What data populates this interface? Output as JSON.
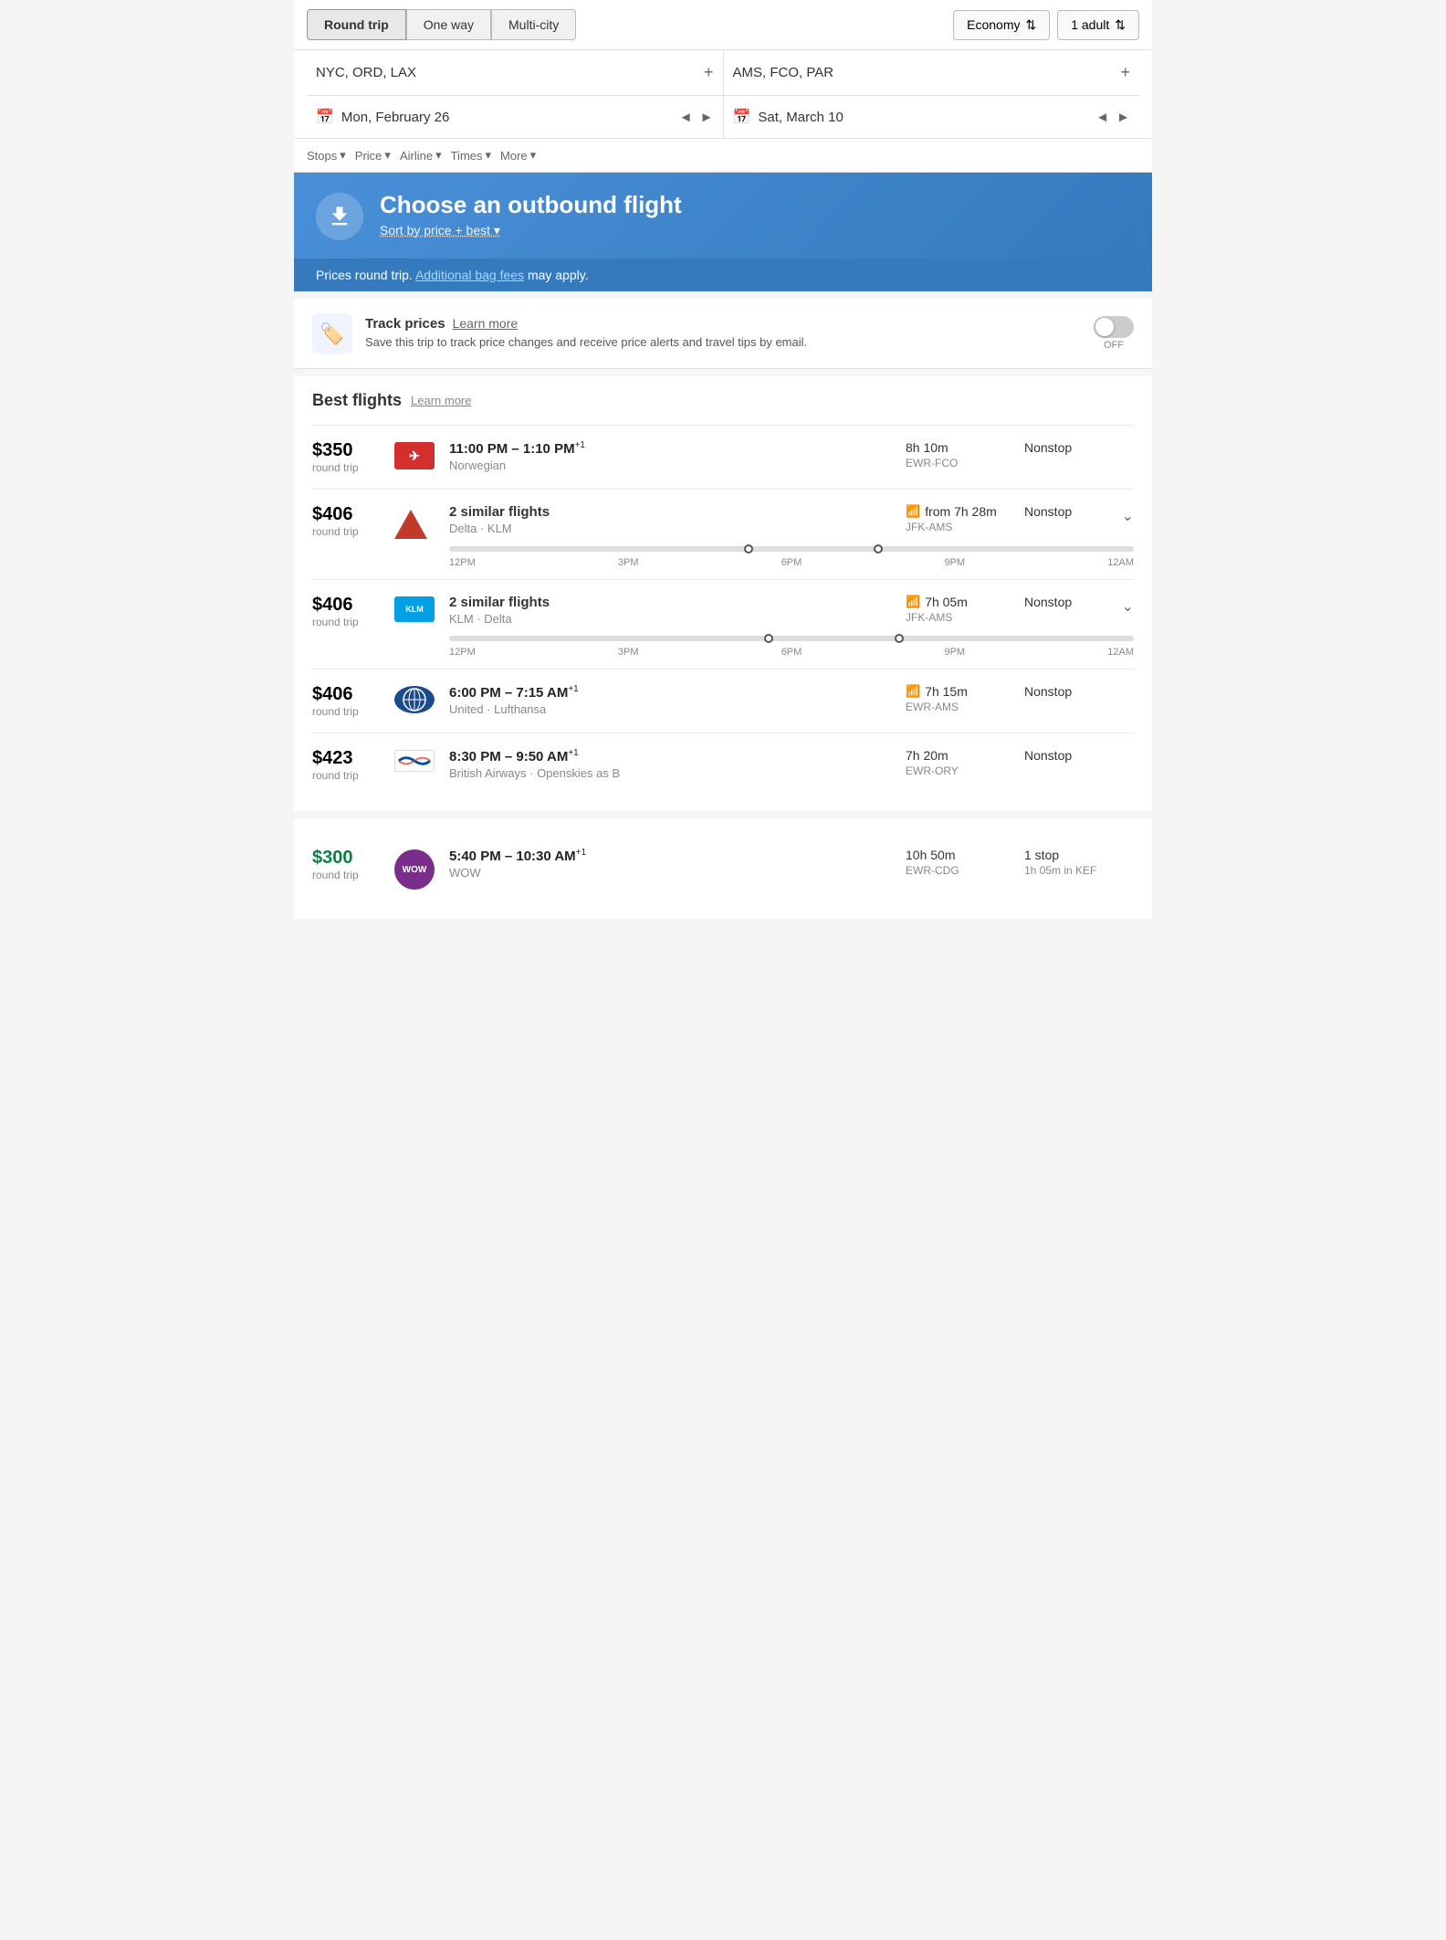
{
  "topBar": {
    "tripTypes": [
      "Round trip",
      "One way",
      "Multi-city"
    ],
    "activeTrip": "Round trip",
    "cabin": "Economy",
    "cabinSymbol": "⇅",
    "passengers": "1 adult",
    "passengersSymbol": "⇅"
  },
  "search": {
    "origin": "NYC, ORD, LAX",
    "destination": "AMS, FCO, PAR",
    "originPlus": "+",
    "destPlus": "+",
    "departDate": "Mon, February 26",
    "returnDate": "Sat, March 10",
    "calIcon": "📅"
  },
  "filters": {
    "items": [
      "Stops",
      "Price",
      "Airline",
      "Times",
      "More"
    ]
  },
  "banner": {
    "title": "Choose an outbound flight",
    "sort": "Sort by price + best ▾",
    "pricesNote": "Prices round trip.",
    "bagFees": "Additional bag fees",
    "bagFeesSuffix": " may apply."
  },
  "trackPrices": {
    "title": "Track prices",
    "learnMore": "Learn more",
    "description": "Save this trip to track price changes and receive price alerts and travel tips by email.",
    "toggleLabel": "OFF"
  },
  "bestFlights": {
    "title": "Best flights",
    "learnMore": "Learn more",
    "flights": [
      {
        "price": "$350",
        "priceType": "round trip",
        "times": "11:00 PM – 1:10 PM",
        "timesSuper": "+1",
        "airline": "Norwegian",
        "duration": "8h 10m",
        "route": "EWR-FCO",
        "stops": "Nonstop",
        "logoColor": "#d32f2f",
        "logoText": "✈",
        "hasTimeline": false,
        "hasExpand": false,
        "hasSimilar": false,
        "hasWifi": false
      },
      {
        "price": "$406",
        "priceType": "round trip",
        "times": "2 similar flights",
        "timesSuper": "",
        "airline": "Delta · KLM",
        "duration": "from 7h 28m",
        "route": "JFK-AMS",
        "stops": "Nonstop",
        "logoColor": "#c0392b",
        "logoText": "▲",
        "hasTimeline": true,
        "hasExpand": true,
        "hasSimilar": true,
        "hasWifi": true,
        "timelineLabels": [
          "12PM",
          "3PM",
          "6PM",
          "9PM",
          "12AM"
        ],
        "dot1Pos": "43%",
        "dot2Pos": "62%"
      },
      {
        "price": "$406",
        "priceType": "round trip",
        "times": "2 similar flights",
        "timesSuper": "",
        "airline": "KLM · Delta",
        "duration": "7h 05m",
        "route": "JFK-AMS",
        "stops": "Nonstop",
        "logoColor": "#00a1e4",
        "logoText": "KLM",
        "hasTimeline": true,
        "hasExpand": true,
        "hasSimilar": true,
        "hasWifi": true,
        "timelineLabels": [
          "12PM",
          "3PM",
          "6PM",
          "9PM",
          "12AM"
        ],
        "dot1Pos": "46%",
        "dot2Pos": "65%"
      },
      {
        "price": "$406",
        "priceType": "round trip",
        "times": "6:00 PM – 7:15 AM",
        "timesSuper": "+1",
        "airline": "United · Lufthansa",
        "duration": "7h 15m",
        "route": "EWR-AMS",
        "stops": "Nonstop",
        "logoColor": "#1a4b8c",
        "logoText": "🌐",
        "hasTimeline": false,
        "hasExpand": false,
        "hasSimilar": false,
        "hasWifi": true
      },
      {
        "price": "$423",
        "priceType": "round trip",
        "times": "8:30 PM – 9:50 AM",
        "timesSuper": "+1",
        "airline": "British Airways · Openskies as B",
        "duration": "7h 20m",
        "route": "EWR-ORY",
        "stops": "Nonstop",
        "logoColor": "#fff",
        "logoText": "BA",
        "hasTimeline": false,
        "hasExpand": false,
        "hasSimilar": false,
        "hasWifi": false
      }
    ]
  },
  "otherFlights": {
    "flights": [
      {
        "price": "$300",
        "priceType": "round trip",
        "priceGreen": true,
        "times": "5:40 PM – 10:30 AM",
        "timesSuper": "+1",
        "airline": "WOW",
        "duration": "10h 50m",
        "route": "EWR-CDG",
        "stops": "1 stop",
        "stopDetail": "1h 05m in KEF",
        "logoColor": "#7b2d8b",
        "logoText": "WOW",
        "hasTimeline": false,
        "hasExpand": false,
        "hasSimilar": false,
        "hasWifi": false
      }
    ]
  }
}
